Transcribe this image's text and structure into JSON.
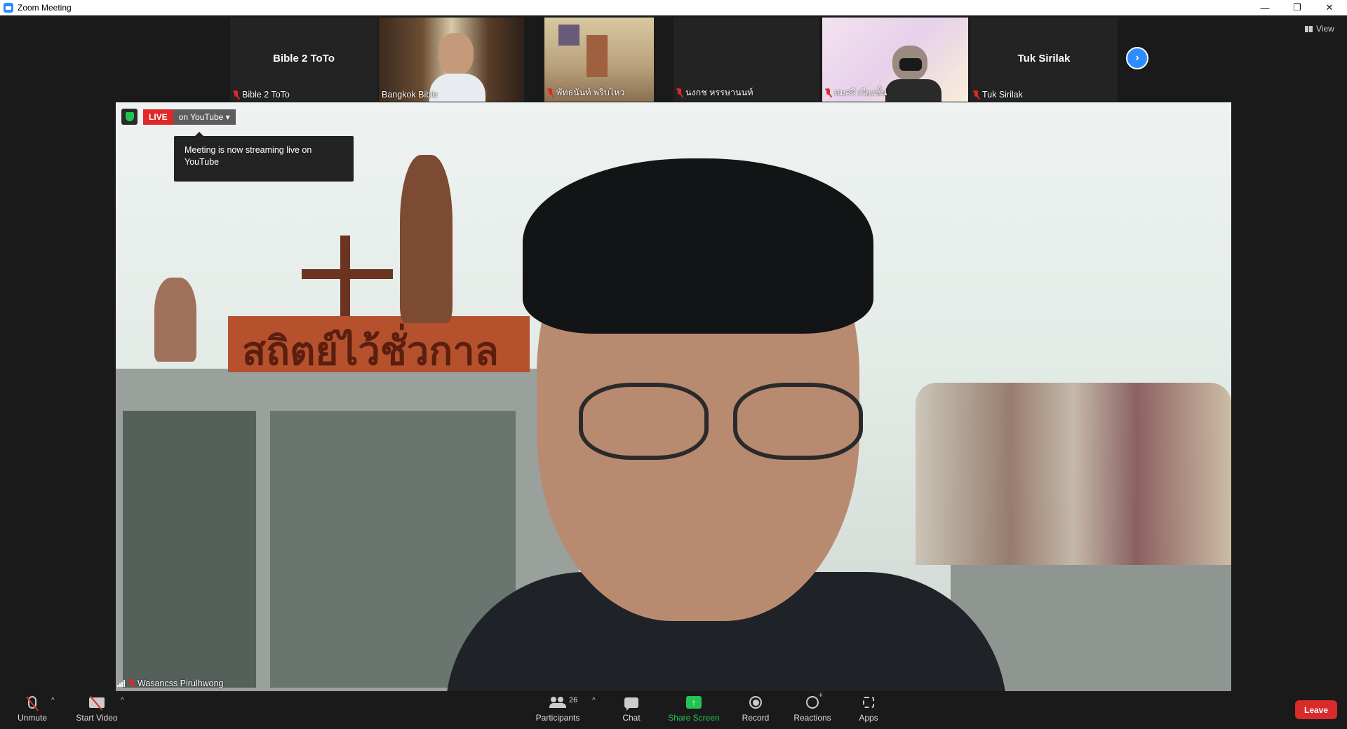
{
  "window": {
    "title": "Zoom Meeting",
    "controls": {
      "minimize": "—",
      "restore": "❐",
      "close": "✕"
    }
  },
  "gallery": {
    "tiles": [
      {
        "name": "Bible 2 ToTo",
        "display_name": "Bible 2 ToTo",
        "muted": true,
        "video": false
      },
      {
        "name": "Bangkok Bible",
        "muted": false,
        "video": true
      },
      {
        "name": "พัทธนันท์ พริบไหว",
        "muted": true,
        "video": true
      },
      {
        "name": "นงกช หรรษานนท์",
        "muted": true,
        "video": false
      },
      {
        "name": "สมศรี เรียงชั้น",
        "muted": true,
        "video": true
      },
      {
        "name": "Tuk Sirilak",
        "display_name": "Tuk Sirilak",
        "muted": true,
        "video": false
      }
    ],
    "next_page_icon": "›",
    "view_label": "View"
  },
  "main": {
    "live_badge": "LIVE",
    "live_platform": "on YouTube",
    "live_caret": "▾",
    "tooltip": "Meeting is now streaming live on YouTube",
    "speaker_name": "Wasancss Pirulhwong",
    "video_sign_text": "สถิตย์ไว้ชั่วกาล"
  },
  "toolbar": {
    "unmute": "Unmute",
    "start_video": "Start Video",
    "participants": "Participants",
    "participants_count": "26",
    "chat": "Chat",
    "share_screen": "Share Screen",
    "record": "Record",
    "reactions": "Reactions",
    "apps": "Apps",
    "leave": "Leave",
    "caret": "^"
  },
  "colors": {
    "accent": "#2d8cff",
    "live_red": "#e02828",
    "share_green": "#23c552",
    "leave_red": "#d92b2b"
  }
}
